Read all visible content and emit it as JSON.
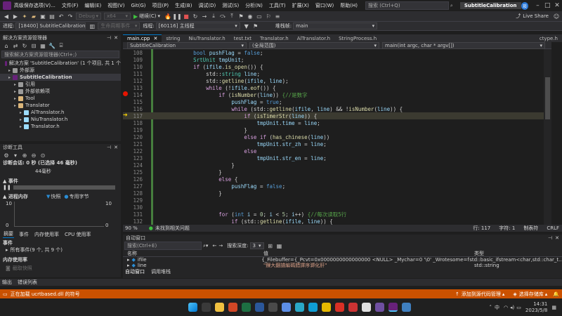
{
  "menubar": {
    "items": [
      "高级保存选项(V)...",
      "文件(F)",
      "编辑(E)",
      "视图(V)",
      "Git(G)",
      "项目(P)",
      "生成(B)",
      "调试(D)",
      "测试(S)",
      "分析(N)",
      "工具(T)",
      "扩展(X)",
      "窗口(W)",
      "帮助(H)"
    ],
    "search_placeholder": "搜索 (Ctrl+Q)",
    "solution_title": "SubtitleCalibration",
    "avatar_letter": "琰",
    "live_share": "Live Share"
  },
  "toolbar1": {
    "config": "Debug",
    "platform": "x64",
    "continue_label": "继续(C)"
  },
  "toolbar2": {
    "process_label": "进程:",
    "process_value": "[18400] SubtitleCalibration.exe",
    "lifecycle_label": "生命周期事件",
    "thread_label": "线程:",
    "thread_value": "[60116] 主线程",
    "stack_label": "堆栈帧:",
    "stack_value": "main"
  },
  "solution_explorer": {
    "title": "解决方案资源管理器",
    "search_placeholder": "搜索解决方案资源管理器(Ctrl+;)",
    "items": [
      {
        "label": "解决方案 'SubtitleCalibration' (1 个项目, 共 1 个",
        "indent": 0
      },
      {
        "label": "外部源",
        "indent": 1
      },
      {
        "label": "SubtitleCalibration",
        "indent": 1,
        "bold": true
      },
      {
        "label": "引用",
        "indent": 2
      },
      {
        "label": "外部依赖项",
        "indent": 2
      },
      {
        "label": "Tool",
        "indent": 2
      },
      {
        "label": "Translator",
        "indent": 2
      },
      {
        "label": "AlTranslator.h",
        "indent": 3
      },
      {
        "label": "NiuTranslator.h",
        "indent": 3
      },
      {
        "label": "Translator.h",
        "indent": 3
      }
    ]
  },
  "diagnostics": {
    "title": "诊断工具",
    "session": "诊断会话: 0 秒 (已选择 46 毫秒)",
    "timeline_label": "44毫秒",
    "events_title": "事件",
    "memory_title": "进程内存",
    "memory_legend_snapshot": "快照",
    "memory_legend_private": "专用字节",
    "axis_top_left": "10",
    "axis_bottom_left": "0",
    "axis_top_right": "10",
    "axis_bottom_right": "0",
    "tabs": [
      "摘要",
      "事件",
      "内存使用率",
      "CPU 使用率"
    ],
    "events_section": "事件",
    "all_events": "所有事件(9 个, 共 9 个)",
    "memory_usage_section": "内存使用率",
    "memory_usage_item": "截取快照"
  },
  "editor": {
    "tabs": [
      "main.cpp",
      "string",
      "NiuTranslator.h",
      "test.txt",
      "Translator.h",
      "AlTranslator.h",
      "StringProcess.h",
      "ctype.h"
    ],
    "nav_project": "SubtitleCalibration",
    "nav_scope": "(全局范围)",
    "nav_function": "main(int argc, char * argv[])",
    "zoom": "90 %",
    "no_issues": "未找到相关问题",
    "line_info": "行: 117",
    "char_info": "字符: 1",
    "indent_info": "制表符",
    "eol_info": "CRLF",
    "lines": [
      {
        "n": "108",
        "html": "        <span class='kw'>bool</span> <span class='var'>pushFlag</span> = <span class='kw'>false</span>;"
      },
      {
        "n": "109",
        "html": "        <span class='ty'>SrtUnit</span> <span class='var'>tmpUnit</span>;"
      },
      {
        "n": "110",
        "html": "        <span class='ctl'>if</span> (<span class='var'>ifile</span>.<span class='fn'>is_open</span>()) {"
      },
      {
        "n": "111",
        "html": "            std::<span class='ty'>string</span> <span class='var'>line</span>;"
      },
      {
        "n": "112",
        "html": "            std::<span class='fn'>getline</span>(<span class='var'>ifile</span>, <span class='var'>line</span>);"
      },
      {
        "n": "113",
        "html": "            <span class='ctl'>while</span> (!<span class='var'>ifile</span>.<span class='fn'>eof</span>()) {"
      },
      {
        "n": "114",
        "html": "                <span class='ctl'>if</span> (<span class='fn'>isNumber</span>(<span class='var'>line</span>)) <span class='cm'>{//是数字</span>"
      },
      {
        "n": "115",
        "html": "                    <span class='var'>pushFlag</span> = <span class='kw'>true</span>;"
      },
      {
        "n": "116",
        "html": "                    <span class='ctl'>while</span> (std::<span class='fn'>getline</span>(<span class='var'>ifile</span>, <span class='var'>line</span>) &amp;&amp; !<span class='fn'>isNumber</span>(<span class='var'>line</span>)) {"
      },
      {
        "n": "117",
        "html": "                        <span class='ctl'>if</span> (<span class='fn'>isTimerStr</span>(<span class='var'>line</span>)) {"
      },
      {
        "n": "118",
        "html": "                            <span class='var'>tmpUnit</span>.<span class='var'>time</span> = <span class='var'>line</span>;"
      },
      {
        "n": "119",
        "html": "                        }"
      },
      {
        "n": "120",
        "html": "                        <span class='ctl'>else if</span> (<span class='fn'>has_chinese</span>(<span class='var'>line</span>))"
      },
      {
        "n": "121",
        "html": "                            <span class='var'>tmpUnit</span>.<span class='var'>str_zh</span> = <span class='var'>line</span>;"
      },
      {
        "n": "122",
        "html": "                        <span class='ctl'>else</span>"
      },
      {
        "n": "123",
        "html": "                            <span class='var'>tmpUnit</span>.<span class='var'>str_en</span> = <span class='var'>line</span>;"
      },
      {
        "n": "124",
        "html": "                    }"
      },
      {
        "n": "125",
        "html": "                }"
      },
      {
        "n": "126",
        "html": "                <span class='ctl'>else</span> {"
      },
      {
        "n": "127",
        "html": "                    <span class='var'>pushFlag</span> = <span class='kw'>false</span>;"
      },
      {
        "n": "128",
        "html": "                }"
      },
      {
        "n": "129",
        "html": ""
      },
      {
        "n": "130",
        "html": ""
      },
      {
        "n": "131",
        "html": "                <span class='ctl'>for</span> (<span class='kw'>int</span> <span class='var'>i</span> = <span class='num'>0</span>; <span class='var'>i</span> &lt; <span class='num'>5</span>; <span class='var'>i</span>++) <span class='cm'>{//每次读取5行</span>"
      },
      {
        "n": "132",
        "html": "                    <span class='ctl'>if</span> (std::<span class='fn'>getline</span>(<span class='var'>ifile</span>, <span class='var'>line</span>)) {"
      }
    ]
  },
  "autos": {
    "title": "自动窗口",
    "search_placeholder": "搜索(Ctrl+E)",
    "search_depth_label": "搜索深度:",
    "search_depth_value": "3",
    "col_name": "名称",
    "col_value": "值",
    "col_type": "类型",
    "rows": [
      {
        "name": "ifile",
        "value": "{_Filebuffer={_Pcvt=0x0000000000000000 <NULL> _Mychar=0 '\\0' _Wrotesome=false ...} }",
        "type": "std::basic_ifstream<char,std::char_t..."
      },
      {
        "name": "line",
        "value": "\"鏁大翻譜編碼錯譯序溮化肝\"",
        "type": "std::string"
      }
    ],
    "tabs": [
      "自动窗口",
      "调用堆栈"
    ]
  },
  "bottom_tabs": [
    "输出",
    "错误列表"
  ],
  "statusbar": {
    "message": "正在加载 ucrtbased.dll 的符号",
    "source_control": "添加到源代码管理",
    "repo": "选择存储库"
  },
  "taskbar": {
    "lang1": "中",
    "time": "14:31",
    "date": "2023/5/8"
  }
}
